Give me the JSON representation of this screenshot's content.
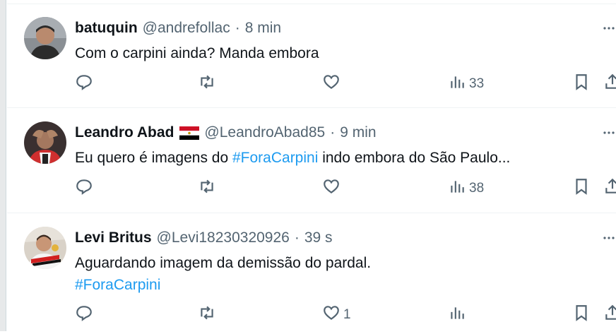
{
  "tweets": [
    {
      "name": "batuquin",
      "handle": "@andrefollac",
      "sep": "·",
      "time": "8 min",
      "text": "Com o carpini ainda? Manda embora",
      "replies": "",
      "retweets": "",
      "likes": "",
      "views": "33"
    },
    {
      "name": "Leandro Abad",
      "handle": "@LeandroAbad85",
      "sep": "·",
      "time": "9 min",
      "text_before": "Eu quero é imagens do ",
      "hashtag": "#ForaCarpini",
      "text_after": " indo embora do São Paulo...",
      "replies": "",
      "retweets": "",
      "likes": "",
      "views": "38"
    },
    {
      "name": "Levi Britus",
      "handle": "@Levi18230320926",
      "sep": "·",
      "time": "39 s",
      "text": "Aguardando imagem da demissão do pardal.",
      "hashtag": "#ForaCarpini",
      "replies": "",
      "retweets": "",
      "likes": "1",
      "views": ""
    }
  ],
  "icons": {
    "reply": "reply-icon",
    "retweet": "retweet-icon",
    "like": "heart-icon",
    "views": "views-icon",
    "bookmark": "bookmark-icon",
    "share": "share-icon",
    "more": "more-icon"
  },
  "colors": {
    "text": "#0f1419",
    "secondary": "#536471",
    "accent": "#1d9bf0",
    "divider": "#eff3f4"
  }
}
